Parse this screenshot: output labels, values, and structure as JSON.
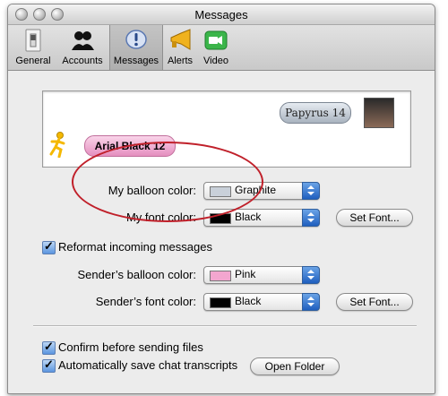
{
  "window": {
    "title": "Messages"
  },
  "toolbar": {
    "items": [
      {
        "label": "General",
        "icon": "light-switch-icon"
      },
      {
        "label": "Accounts",
        "icon": "buddies-icon"
      },
      {
        "label": "Messages",
        "icon": "exclamation-bubble-icon",
        "selected": true
      },
      {
        "label": "Alerts",
        "icon": "megaphone-icon"
      },
      {
        "label": "Video",
        "icon": "video-camera-icon"
      }
    ]
  },
  "preview": {
    "my_bubble_text": "Papyrus 14",
    "sender_bubble_text": "Arial Black 12"
  },
  "my_balloon": {
    "label": "My balloon color:",
    "value": "Graphite",
    "swatch": "#c9d0d9"
  },
  "my_font": {
    "label": "My font color:",
    "value": "Black",
    "swatch": "#000000",
    "button": "Set Font..."
  },
  "reformat": {
    "label": "Reformat incoming messages",
    "checked": true
  },
  "sender_balloon": {
    "label": "Sender’s balloon color:",
    "value": "Pink",
    "swatch": "#f3a6cf"
  },
  "sender_font": {
    "label": "Sender’s font color:",
    "value": "Black",
    "swatch": "#000000",
    "button": "Set Font..."
  },
  "confirm_files": {
    "label": "Confirm before sending files",
    "checked": true
  },
  "save_transcripts": {
    "label": "Automatically save chat transcripts",
    "checked": true,
    "button": "Open Folder"
  },
  "colors": {
    "highlight_ellipse": "#c0202a",
    "window_bg": "#ececec"
  }
}
